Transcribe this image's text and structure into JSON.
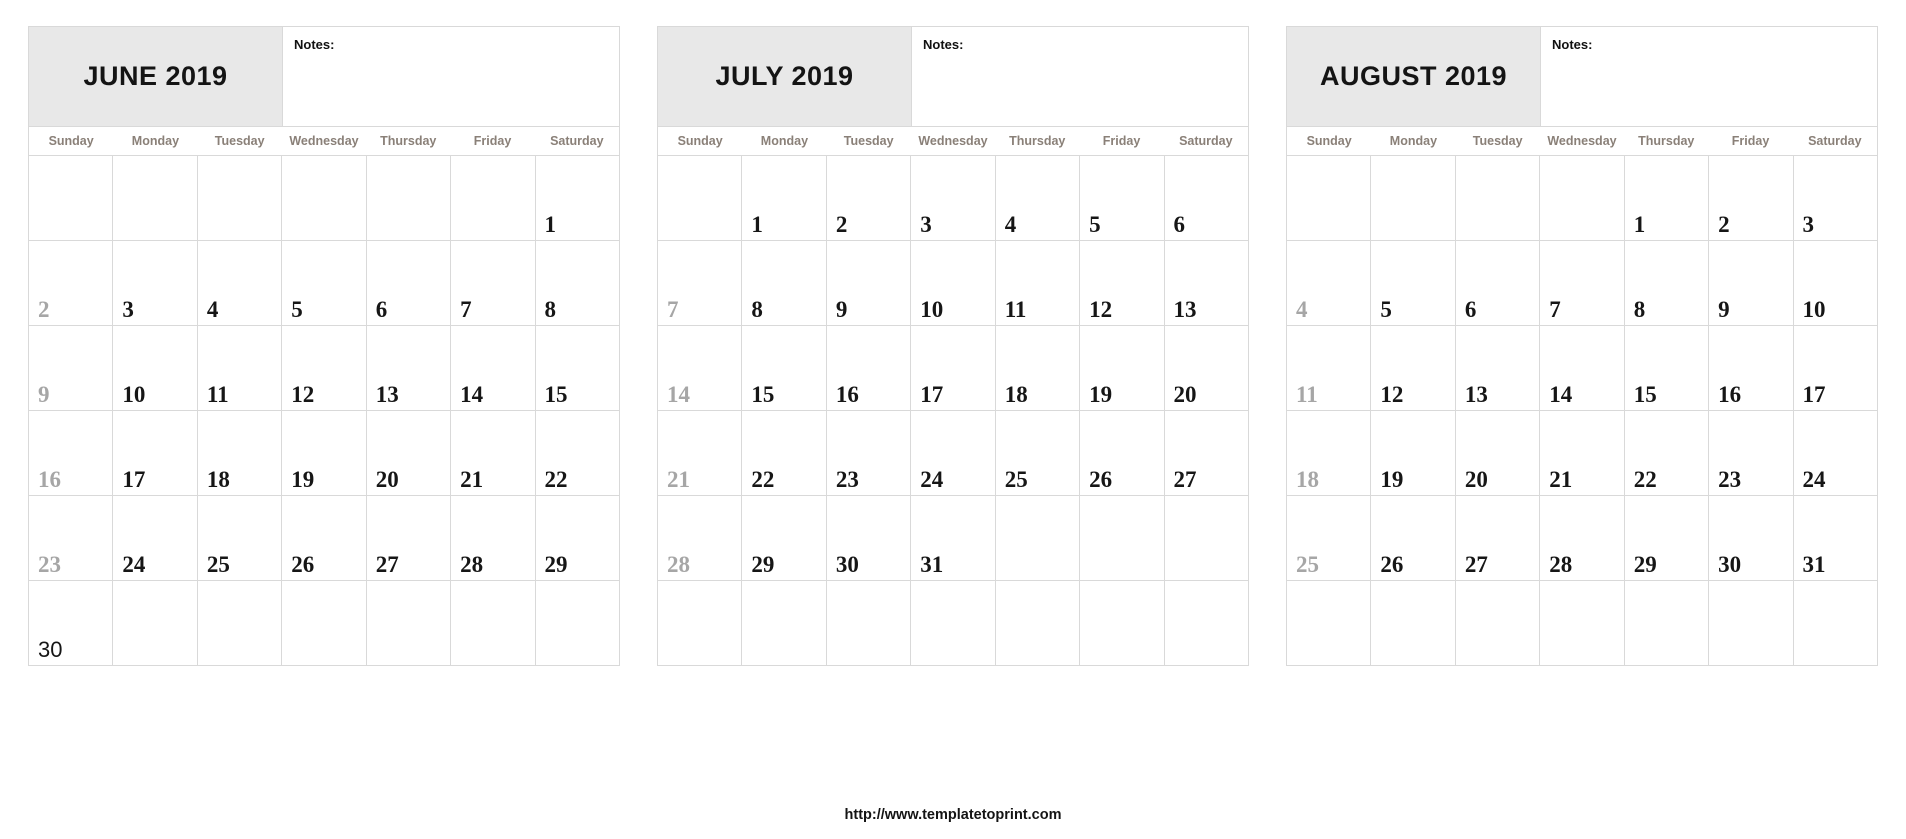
{
  "footer": {
    "url": "http://www.templatetoprint.com"
  },
  "notes_label": "Notes:",
  "weekdays": [
    "Sunday",
    "Monday",
    "Tuesday",
    "Wednesday",
    "Thursday",
    "Friday",
    "Saturday"
  ],
  "colors": {
    "title_band": "#e8e8e8",
    "grid_line": "#d9d9d9",
    "weekday_text": "#8a8078",
    "date_text": "#161616",
    "sunday_text": "#a6a6a6",
    "page_background": "#ffffff"
  },
  "months": [
    {
      "title": "JUNE 2019",
      "notes_label": "Notes:",
      "weeks": [
        [
          null,
          null,
          null,
          null,
          null,
          null,
          "1"
        ],
        [
          "2",
          "3",
          "4",
          "5",
          "6",
          "7",
          "8"
        ],
        [
          "9",
          "10",
          "11",
          "12",
          "13",
          "14",
          "15"
        ],
        [
          "16",
          "17",
          "18",
          "19",
          "20",
          "21",
          "22"
        ],
        [
          "23",
          "24",
          "25",
          "26",
          "27",
          "28",
          "29"
        ],
        [
          "30",
          null,
          null,
          null,
          null,
          null,
          null
        ]
      ]
    },
    {
      "title": "JULY 2019",
      "notes_label": "Notes:",
      "weeks": [
        [
          null,
          "1",
          "2",
          "3",
          "4",
          "5",
          "6"
        ],
        [
          "7",
          "8",
          "9",
          "10",
          "11",
          "12",
          "13"
        ],
        [
          "14",
          "15",
          "16",
          "17",
          "18",
          "19",
          "20"
        ],
        [
          "21",
          "22",
          "23",
          "24",
          "25",
          "26",
          "27"
        ],
        [
          "28",
          "29",
          "30",
          "31",
          null,
          null,
          null
        ],
        [
          null,
          null,
          null,
          null,
          null,
          null,
          null
        ]
      ]
    },
    {
      "title": "AUGUST 2019",
      "notes_label": "Notes:",
      "weeks": [
        [
          null,
          null,
          null,
          null,
          "1",
          "2",
          "3"
        ],
        [
          "4",
          "5",
          "6",
          "7",
          "8",
          "9",
          "10"
        ],
        [
          "11",
          "12",
          "13",
          "14",
          "15",
          "16",
          "17"
        ],
        [
          "18",
          "19",
          "20",
          "21",
          "22",
          "23",
          "24"
        ],
        [
          "25",
          "26",
          "27",
          "28",
          "29",
          "30",
          "31"
        ],
        [
          null,
          null,
          null,
          null,
          null,
          null,
          null
        ]
      ]
    }
  ]
}
